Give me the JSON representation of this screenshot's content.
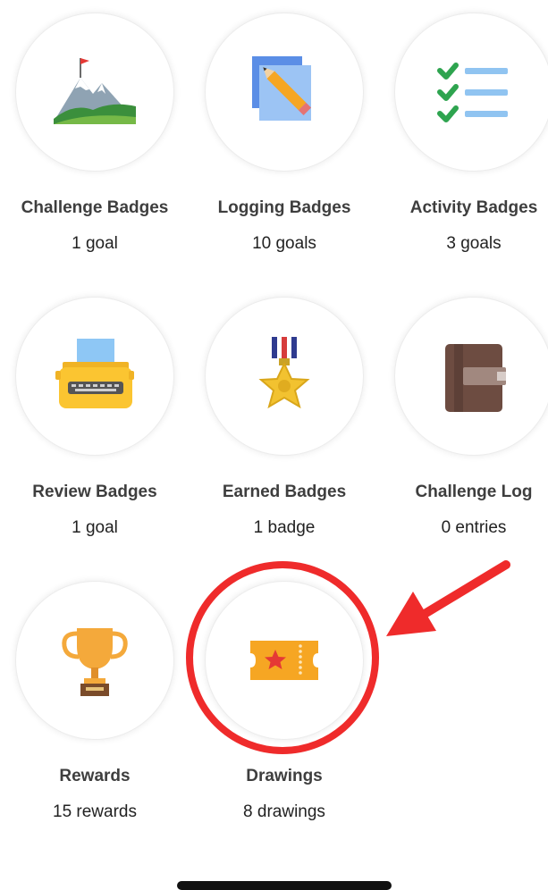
{
  "tiles": [
    {
      "title": "Challenge Badges",
      "subtitle": "1 goal",
      "icon": "mountain-flag-icon"
    },
    {
      "title": "Logging Badges",
      "subtitle": "10 goals",
      "icon": "pencil-notes-icon"
    },
    {
      "title": "Activity Badges",
      "subtitle": "3 goals",
      "icon": "checklist-icon"
    },
    {
      "title": "Review Badges",
      "subtitle": "1 goal",
      "icon": "typewriter-icon"
    },
    {
      "title": "Earned Badges",
      "subtitle": "1 badge",
      "icon": "medal-icon"
    },
    {
      "title": "Challenge Log",
      "subtitle": "0 entries",
      "icon": "notebook-icon"
    },
    {
      "title": "Rewards",
      "subtitle": "15 rewards",
      "icon": "trophy-icon"
    },
    {
      "title": "Drawings",
      "subtitle": "8 drawings",
      "icon": "ticket-icon"
    }
  ],
  "annotation": {
    "color": "#ef2b2b",
    "target": "Drawings"
  }
}
